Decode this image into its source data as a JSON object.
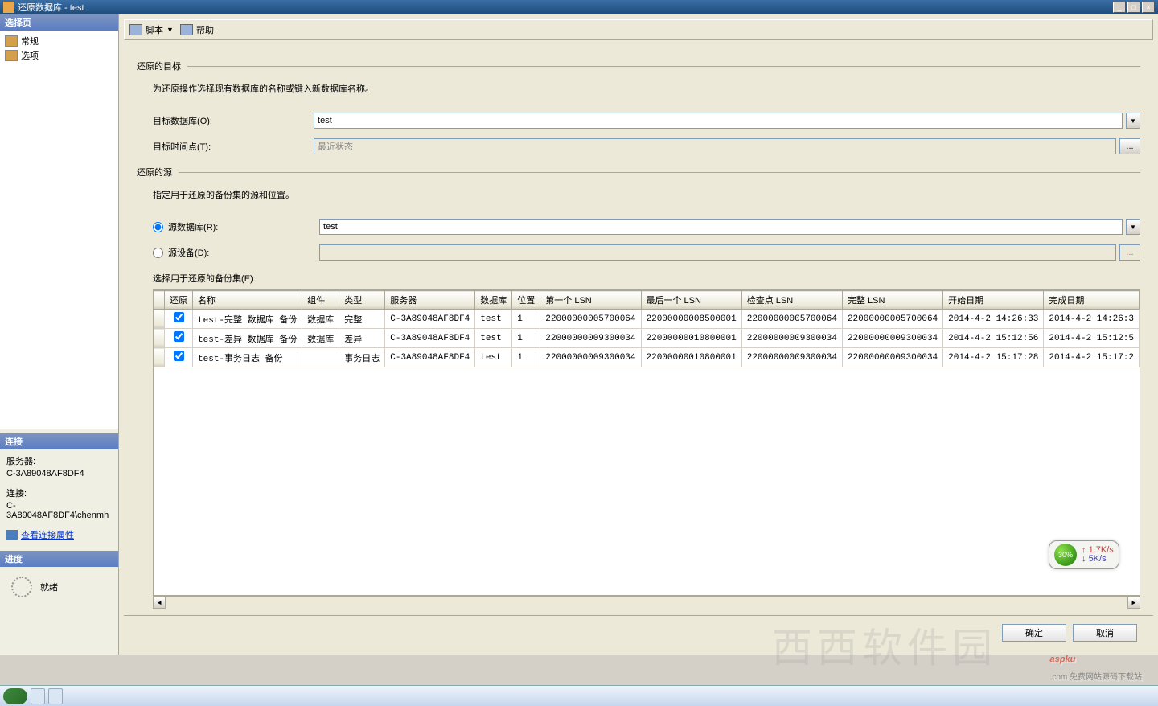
{
  "window": {
    "title": "还原数据库 - test"
  },
  "left": {
    "header": "选择页",
    "pages": [
      {
        "label": "常规"
      },
      {
        "label": "选项"
      }
    ],
    "connection": {
      "header": "连接",
      "server_label": "服务器:",
      "server": "C-3A89048AF8DF4",
      "conn_label": "连接:",
      "conn": "C-3A89048AF8DF4\\chenmh",
      "view_props": "查看连接属性"
    },
    "progress": {
      "header": "进度",
      "status": "就绪"
    }
  },
  "toolbar": {
    "script": "脚本",
    "help": "帮助"
  },
  "content": {
    "target_section": "还原的目标",
    "target_desc": "为还原操作选择现有数据库的名称或键入新数据库名称。",
    "target_db_label": "目标数据库(O):",
    "target_db": "test",
    "target_time_label": "目标时间点(T):",
    "target_time": "最近状态",
    "source_section": "还原的源",
    "source_desc": "指定用于还原的备份集的源和位置。",
    "src_db_label": "源数据库(R):",
    "src_db": "test",
    "src_dev_label": "源设备(D):",
    "grid_label": "选择用于还原的备份集(E):",
    "columns": [
      "还原",
      "名称",
      "组件",
      "类型",
      "服务器",
      "数据库",
      "位置",
      "第一个 LSN",
      "最后一个 LSN",
      "检查点 LSN",
      "完整 LSN",
      "开始日期",
      "完成日期"
    ],
    "rows": [
      {
        "chk": true,
        "name": "test-完整 数据库 备份",
        "comp": "数据库",
        "type": "完整",
        "server": "C-3A89048AF8DF4",
        "db": "test",
        "pos": "1",
        "lsn1": "22000000005700064",
        "lsn2": "22000000008500001",
        "lsn3": "22000000005700064",
        "lsn4": "22000000005700064",
        "start": "2014-4-2 14:26:33",
        "end": "2014-4-2 14:26:3"
      },
      {
        "chk": true,
        "name": "test-差异 数据库 备份",
        "comp": "数据库",
        "type": "差异",
        "server": "C-3A89048AF8DF4",
        "db": "test",
        "pos": "1",
        "lsn1": "22000000009300034",
        "lsn2": "22000000010800001",
        "lsn3": "22000000009300034",
        "lsn4": "22000000009300034",
        "start": "2014-4-2 15:12:56",
        "end": "2014-4-2 15:12:5"
      },
      {
        "chk": true,
        "name": "test-事务日志  备份",
        "comp": "",
        "type": "事务日志",
        "server": "C-3A89048AF8DF4",
        "db": "test",
        "pos": "1",
        "lsn1": "22000000009300034",
        "lsn2": "22000000010800001",
        "lsn3": "22000000009300034",
        "lsn4": "22000000009300034",
        "start": "2014-4-2 15:17:28",
        "end": "2014-4-2 15:17:2"
      }
    ]
  },
  "buttons": {
    "ok": "确定",
    "cancel": "取消"
  },
  "overlay": {
    "pct": "30%",
    "up": "1.7K/s",
    "dn": "5K/s"
  },
  "watermark": {
    "text": "aspku",
    "sub": ".com  免费网站源码下载站"
  }
}
